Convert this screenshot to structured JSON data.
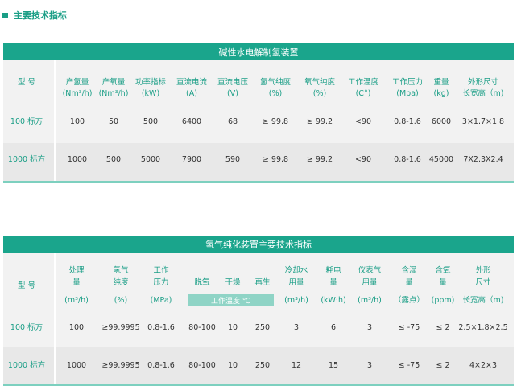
{
  "section_title": "主要技术指标",
  "table1": {
    "title": "碱性水电解制氢装置",
    "headers": [
      [
        "型 号",
        ""
      ],
      [
        "产氢量",
        "(Nm³/h)"
      ],
      [
        "产氧量",
        "(Nm³/h)"
      ],
      [
        "功率指标",
        "(kW)"
      ],
      [
        "直流电流",
        "(A)"
      ],
      [
        "直流电压",
        "(V)"
      ],
      [
        "氢气纯度",
        "(%)"
      ],
      [
        "氧气纯度",
        "(%)"
      ],
      [
        "工作温度",
        "(C°)"
      ],
      [
        "工作压力",
        "(Mpa)"
      ],
      [
        "重量",
        "(kg)"
      ],
      [
        "外形尺寸",
        "长宽高（m)"
      ]
    ],
    "rows": [
      [
        "100 标方",
        "100",
        "50",
        "500",
        "6400",
        "68",
        "≥ 99.8",
        "≥ 99.2",
        "<90",
        "0.8-1.6",
        "6000",
        "3×1.7×1.8"
      ],
      [
        "1000 标方",
        "1000",
        "500",
        "5000",
        "7900",
        "590",
        "≥ 99.8",
        "≥ 99.2",
        "<90",
        "0.8-1.6",
        "45000",
        "7X2.3X2.4"
      ]
    ]
  },
  "table2": {
    "title": "氢气纯化装置主要技术指标",
    "model_label": "型 号",
    "temp_band": "工作温度 ℃",
    "headers": [
      [
        "处理",
        "量",
        "(m³/h)"
      ],
      [
        "氢气",
        "纯度",
        "(%)"
      ],
      [
        "工作",
        "压力",
        "(MPa)"
      ],
      [
        "",
        "脱氧",
        ""
      ],
      [
        "",
        "干燥",
        ""
      ],
      [
        "",
        "再生",
        ""
      ],
      [
        "冷却水",
        "用量",
        "(m³/h)"
      ],
      [
        "耗电",
        "量",
        "(kW·h)"
      ],
      [
        "仪表气",
        "用量",
        "(m³/h)"
      ],
      [
        "含湿",
        "量",
        "（露点）"
      ],
      [
        "含氧",
        "量",
        "(ppm)"
      ],
      [
        "外形",
        "尺寸",
        "长宽高（m)"
      ]
    ],
    "rows": [
      [
        "100 标方",
        "100",
        "≥99.9995",
        "0.8-1.6",
        "80-100",
        "10",
        "250",
        "3",
        "6",
        "3",
        "≤ -75",
        "≤ 2",
        "2.5×1.8×2.5"
      ],
      [
        "1000 标方",
        "1000",
        "≥99.9995",
        "0.8-1.6",
        "80-100",
        "10",
        "250",
        "12",
        "15",
        "3",
        "≤ -75",
        "≤ 2",
        "4×2×3"
      ]
    ]
  }
}
